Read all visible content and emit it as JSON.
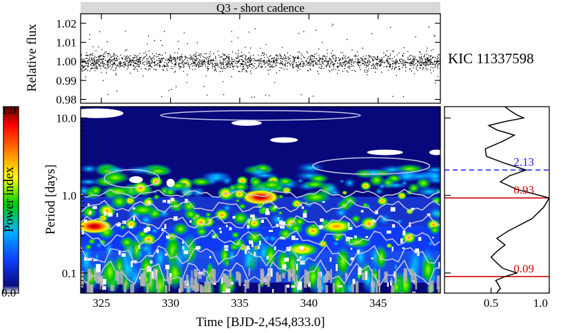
{
  "chart_data": [
    {
      "type": "scatter",
      "title": "Q3 - short cadence",
      "ylabel": "Relative flux",
      "xlabel": "",
      "xlim": [
        323.5,
        349.5
      ],
      "ylim": [
        0.978,
        1.025
      ],
      "yticks": [
        0.98,
        0.99,
        1.0,
        1.01,
        1.02
      ],
      "yticklabels": [
        "0.98",
        "0.99",
        "1.00",
        "1.01",
        "1.02"
      ],
      "xticks": [
        325,
        330,
        335,
        340,
        345
      ],
      "series": [
        {
          "mean": 1.0,
          "scatter": 0.0045,
          "min": 0.981,
          "max": 1.02
        }
      ],
      "annotation": "KIC 11337598"
    },
    {
      "type": "heatmap",
      "xlabel": "Time [BJD-2,454,833.0]",
      "ylabel": "Period [days]",
      "xlim": [
        323.5,
        349.5
      ],
      "ylim": [
        0.055,
        14.0
      ],
      "yscale": "log",
      "xticks": [
        325,
        330,
        335,
        340,
        345
      ],
      "xticklabels": [
        "325",
        "330",
        "335",
        "340",
        "345"
      ],
      "yticks": [
        0.1,
        1.0,
        10.0
      ],
      "yticklabels": [
        "0.1",
        "1.0",
        "10.0"
      ],
      "colorbar": {
        "label": "Power index",
        "range": [
          0.0,
          1.0
        ],
        "ticklabels": [
          "0.0",
          "1.0"
        ],
        "colors": [
          "#ffffff",
          "#0a0a80",
          "#1040ff",
          "#00b0ff",
          "#00d000",
          "#ffff00",
          "#ff8000",
          "#ff0000",
          "#600000"
        ]
      },
      "hotspots": [
        {
          "x": 324.5,
          "period": 0.4,
          "power": 0.85
        },
        {
          "x": 336.5,
          "period": 0.95,
          "power": 0.9
        },
        {
          "x": 339.5,
          "period": 0.2,
          "power": 0.7
        },
        {
          "x": 342.0,
          "period": 0.4,
          "power": 0.8
        },
        {
          "x": 328.0,
          "period": 0.65,
          "power": 0.6
        },
        {
          "x": 340.5,
          "period": 0.95,
          "power": 0.6
        },
        {
          "x": 326.0,
          "period": 1.7,
          "power": 0.55
        },
        {
          "x": 343.5,
          "period": 0.25,
          "power": 0.6
        }
      ]
    },
    {
      "type": "line",
      "xlabel": "",
      "ylabel": "",
      "xlim": [
        0.1,
        1.0
      ],
      "ylim": [
        0.055,
        14.0
      ],
      "yscale": "log",
      "xticks": [
        0.5,
        1.0
      ],
      "xticklabels": [
        "0.5",
        "1.0"
      ],
      "x": [
        0.55,
        0.58,
        0.56,
        0.54,
        0.62,
        0.72,
        0.6,
        0.55,
        0.5,
        0.55,
        0.62,
        0.55,
        0.65,
        0.85,
        0.95,
        1.0,
        0.72,
        0.58,
        0.66,
        0.8,
        0.62,
        0.46,
        0.45,
        0.6,
        0.7,
        0.55,
        0.48,
        0.62,
        0.78,
        0.72,
        0.66,
        0.62
      ],
      "y": [
        0.056,
        0.063,
        0.072,
        0.08,
        0.09,
        0.1,
        0.115,
        0.135,
        0.16,
        0.19,
        0.23,
        0.28,
        0.35,
        0.5,
        0.7,
        0.93,
        1.2,
        1.5,
        1.8,
        2.13,
        2.6,
        3.2,
        4.0,
        5.0,
        6.0,
        7.0,
        8.0,
        9.0,
        10.0,
        11.0,
        12.5,
        14.0
      ],
      "hlines": [
        {
          "period": 2.13,
          "label": "2.13",
          "color": "#1a1aff",
          "style": "dashed"
        },
        {
          "period": 0.93,
          "label": "0.93",
          "color": "#cc0000",
          "style": "solid"
        },
        {
          "period": 0.09,
          "label": "0.09",
          "color": "#cc0000",
          "style": "solid"
        }
      ]
    }
  ]
}
